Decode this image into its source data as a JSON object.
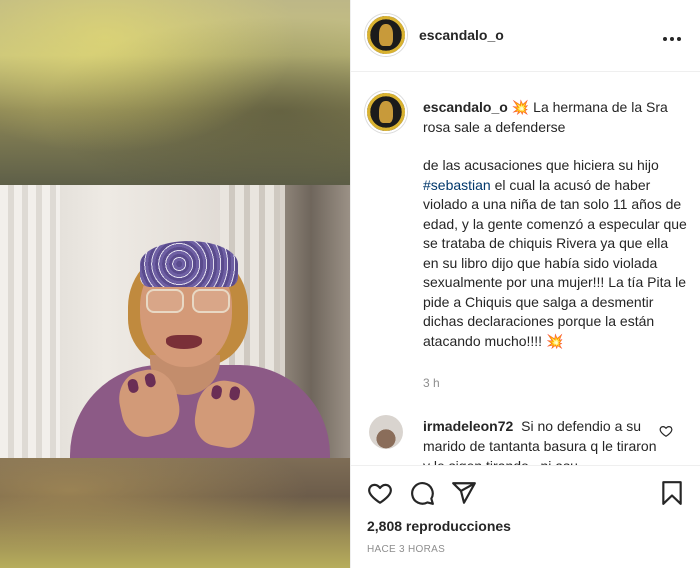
{
  "post": {
    "username": "escandalo_o",
    "caption_line1": "La hermana de la Sra rosa sale a defenderse",
    "caption_para_before_tag": "de las acusaciones que hiciera su hijo",
    "hashtag": "#sebastian",
    "caption_para_after_tag": "el cual la acusó de haber violado a una niña de tan solo 11 años de edad, y la gente comenzó a especular que se trataba de chiquis Rivera ya que ella en su libro dijo que había sido violada sexualmente por una mujer!!! La tía Pita le pide a Chiquis que salga a desmentir dichas declaraciones porque la están atacando mucho!!!!",
    "emoji_symbol": "💥",
    "time_ago": "3 h"
  },
  "reply": {
    "username": "irmadeleon72",
    "text": "Si no defendio a su marido de tantanta basura q le tiraron y le sigen tirando.. ni asu"
  },
  "actions": {
    "views": "2,808 reproducciones",
    "posted": "HACE 3 HORAS"
  },
  "icons": {
    "more": "more-options-icon",
    "like": "heart-icon",
    "comment": "comment-icon",
    "share": "paper-plane-icon",
    "save": "bookmark-icon"
  }
}
